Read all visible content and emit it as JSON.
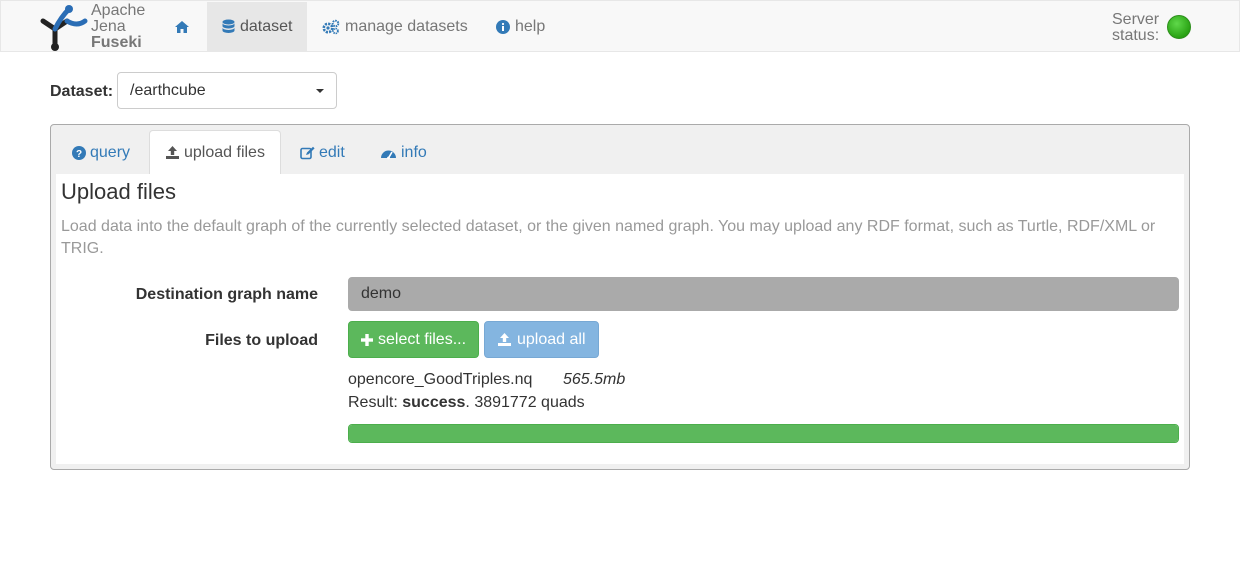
{
  "navbar": {
    "brand": {
      "line1": "Apache",
      "line2": "Jena",
      "line3": "Fuseki"
    },
    "items": [
      {
        "label": "",
        "icon": "home-icon"
      },
      {
        "label": "dataset",
        "icon": "database-icon",
        "active": true
      },
      {
        "label": "manage datasets",
        "icon": "cogs-icon"
      },
      {
        "label": "help",
        "icon": "info-icon"
      }
    ],
    "server_status": {
      "line1": "Server",
      "line2": "status:",
      "color": "#2aa314"
    }
  },
  "dataset": {
    "label": "Dataset:",
    "selected": "/earthcube"
  },
  "tabs": [
    {
      "label": "query",
      "icon": "question-circle-icon"
    },
    {
      "label": "upload files",
      "icon": "upload-icon",
      "active": true
    },
    {
      "label": "edit",
      "icon": "edit-icon"
    },
    {
      "label": "info",
      "icon": "dashboard-icon"
    }
  ],
  "upload": {
    "title": "Upload files",
    "description": "Load data into the default graph of the currently selected dataset, or the given named graph. You may upload any RDF format, such as Turtle, RDF/XML or TRIG.",
    "destination_label": "Destination graph name",
    "destination_value": "demo",
    "files_label": "Files to upload",
    "select_button": "select files...",
    "upload_button": "upload all",
    "file": {
      "name": "opencore_GoodTriples.nq",
      "size": "565.5mb",
      "result_prefix": "Result: ",
      "result_status": "success",
      "result_suffix": ". 3891772 quads",
      "progress_percent": 100
    }
  },
  "colors": {
    "success": "#5cb85c",
    "link": "#337ab7",
    "primary_disabled": "#84b5e0"
  }
}
